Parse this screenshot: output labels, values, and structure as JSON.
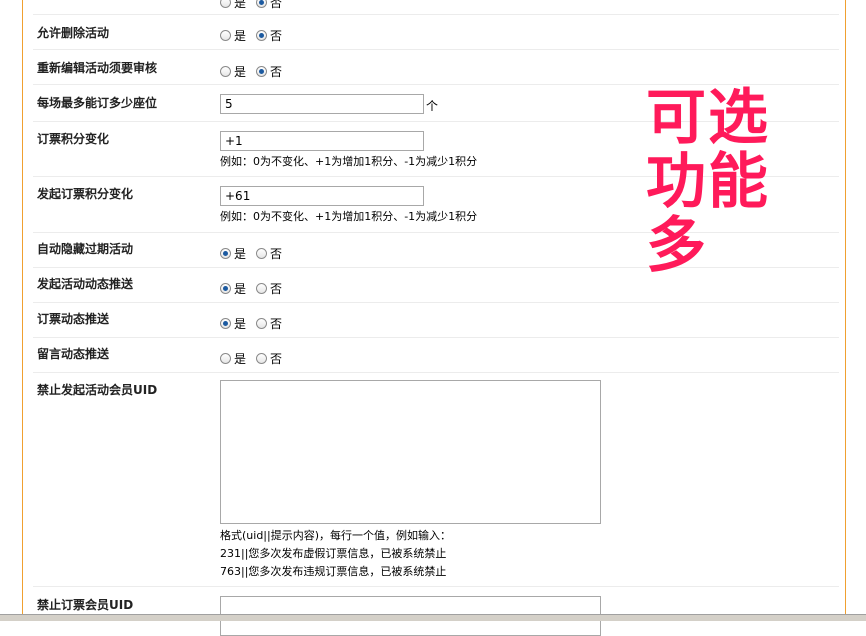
{
  "rows": [
    {
      "label": "允许删除活动",
      "opt_yes": "是",
      "opt_no": "否"
    },
    {
      "label": "重新编辑活动须要审核",
      "opt_yes": "是",
      "opt_no": "否"
    },
    {
      "label": "每场最多能订多少座位",
      "value": "5",
      "unit": "个"
    },
    {
      "label": "订票积分变化",
      "value": "+1",
      "hint": "例如：0为不变化、+1为增加1积分、-1为减少1积分"
    },
    {
      "label": "发起订票积分变化",
      "value": "+61",
      "hint": "例如：0为不变化、+1为增加1积分、-1为减少1积分"
    },
    {
      "label": "自动隐藏过期活动",
      "opt_yes": "是",
      "opt_no": "否"
    },
    {
      "label": "发起活动动态推送",
      "opt_yes": "是",
      "opt_no": "否"
    },
    {
      "label": "订票动态推送",
      "opt_yes": "是",
      "opt_no": "否"
    },
    {
      "label": "留言动态推送",
      "opt_yes": "是",
      "opt_no": "否"
    },
    {
      "label": "禁止发起活动会员UID",
      "value": "",
      "hint_lines": [
        "格式(uid||提示内容)，每行一个值，例如输入：",
        "231||您多次发布虚假订票信息，已被系统禁止",
        "763||您多次发布违规订票信息，已被系统禁止"
      ]
    },
    {
      "label": "禁止订票会员UID",
      "value": ""
    }
  ],
  "top_partial": {
    "opt_yes": "是",
    "opt_no": "否"
  },
  "overlay": {
    "line1": "可选",
    "line2": "功能",
    "line3": "多"
  }
}
